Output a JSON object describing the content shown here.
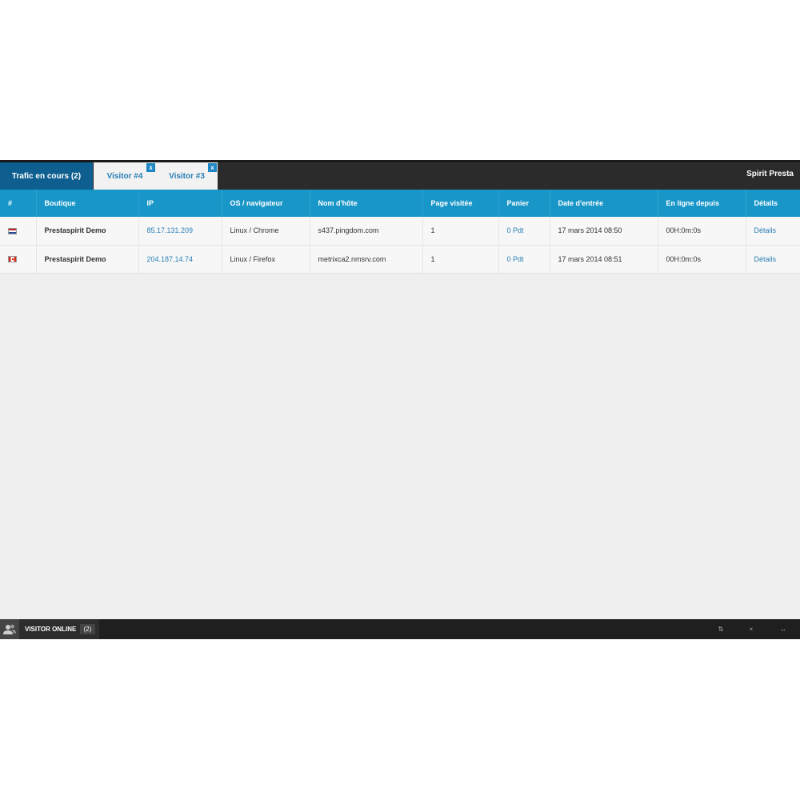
{
  "tabs": {
    "active_label": "Trafic en cours (2)",
    "visitor_tabs": [
      {
        "label": "Visitor #4",
        "close": "x"
      },
      {
        "label": "Visitor #3",
        "close": "x"
      }
    ],
    "brand": "Spirit Presta"
  },
  "table": {
    "headers": [
      "#",
      "Boutique",
      "IP",
      "OS / navigateur",
      "Nom d'hôte",
      "Page visitée",
      "Panier",
      "Date d'entrée",
      "En ligne depuis",
      "Détails"
    ],
    "rows": [
      {
        "flag": "flag-netherlands-icon",
        "shop": "Prestaspirit Demo",
        "ip": "85.17.131.209",
        "os": "Linux / Chrome",
        "host": "s437.pingdom.com",
        "pages": "1",
        "cart": "0 Pdt",
        "date": "17 mars 2014 08:50",
        "online": "00H:0m:0s",
        "details": "Détails"
      },
      {
        "flag": "flag-canada-icon",
        "shop": "Prestaspirit Demo",
        "ip": "204.187.14.74",
        "os": "Linux / Firefox",
        "host": "metrixca2.nmsrv.com",
        "pages": "1",
        "cart": "0 Pdt",
        "date": "17 mars 2014 08:51",
        "online": "00H:0m:0s",
        "details": "Détails"
      }
    ]
  },
  "footer": {
    "label": "VISITOR ONLINE",
    "count": "(2)",
    "controls": {
      "sort": "⇅",
      "close": "×",
      "expand": "↔"
    }
  },
  "colors": {
    "accent": "#1896c8",
    "active_tab": "#0e5f8f",
    "link": "#2a7fb5",
    "bar": "#2b2b2b"
  }
}
